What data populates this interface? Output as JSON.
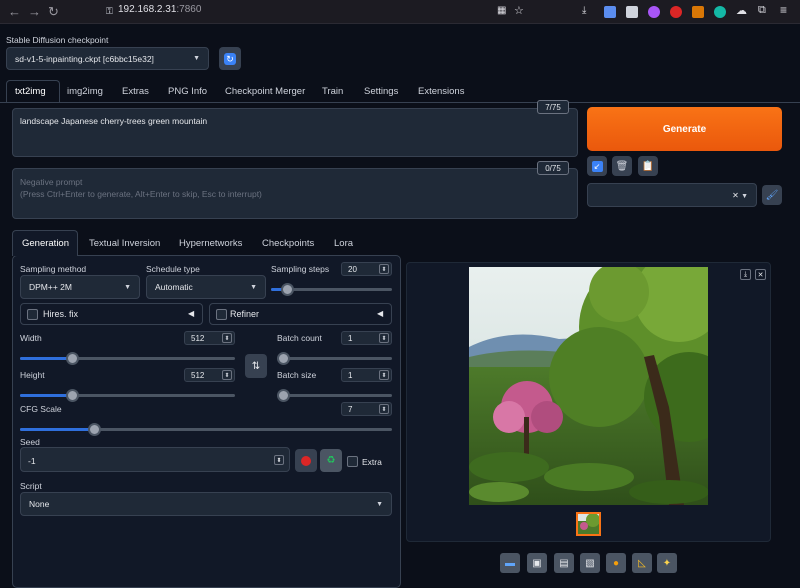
{
  "browser": {
    "url_host": "192.168.2.31",
    "url_port": ":7860"
  },
  "checkpoint": {
    "label": "Stable Diffusion checkpoint",
    "value": "sd-v1-5-inpainting.ckpt [c6bbc15e32]"
  },
  "main_tabs": [
    "txt2img",
    "img2img",
    "Extras",
    "PNG Info",
    "Checkpoint Merger",
    "Train",
    "Settings",
    "Extensions"
  ],
  "prompt": {
    "value": "landscape Japanese cherry-trees green mountain",
    "counter": "7/75"
  },
  "negative": {
    "placeholder_line1": "Negative prompt",
    "placeholder_line2": "(Press Ctrl+Enter to generate, Alt+Enter to skip, Esc to interrupt)",
    "counter": "0/75"
  },
  "generate_label": "Generate",
  "sub_tabs": [
    "Generation",
    "Textual Inversion",
    "Hypernetworks",
    "Checkpoints",
    "Lora"
  ],
  "sampling_method": {
    "label": "Sampling method",
    "value": "DPM++ 2M"
  },
  "schedule_type": {
    "label": "Schedule type",
    "value": "Automatic"
  },
  "sampling_steps": {
    "label": "Sampling steps",
    "value": "20",
    "fraction": 0.13
  },
  "hires_fix": {
    "label": "Hires. fix"
  },
  "refiner": {
    "label": "Refiner"
  },
  "width": {
    "label": "Width",
    "value": "512",
    "fraction": 0.24
  },
  "height": {
    "label": "Height",
    "value": "512",
    "fraction": 0.24
  },
  "batch_count": {
    "label": "Batch count",
    "value": "1",
    "fraction": 0.0
  },
  "batch_size": {
    "label": "Batch size",
    "value": "1",
    "fraction": 0.0
  },
  "cfg_scale": {
    "label": "CFG Scale",
    "value": "7",
    "fraction": 0.2
  },
  "seed": {
    "label": "Seed",
    "value": "-1",
    "extra_label": "Extra"
  },
  "script": {
    "label": "Script",
    "value": "None"
  },
  "colors": {
    "accent": "#f97316",
    "slider": "#2f6fdc",
    "background": "#0b0f19"
  },
  "icons": [
    "refresh-icon",
    "arrow-icon",
    "trash-icon",
    "clipboard-icon",
    "brush-icon",
    "dice-icon",
    "recycle-icon",
    "swap-icon",
    "download-icon",
    "close-icon",
    "folder-icon",
    "save-icon",
    "zip-icon",
    "image-icon",
    "palette-icon",
    "ruler-icon",
    "sparkle-icon"
  ]
}
